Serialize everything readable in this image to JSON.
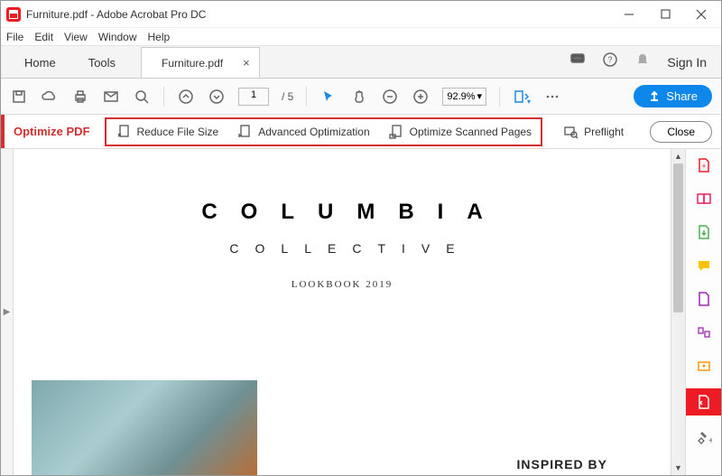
{
  "titlebar": {
    "title": "Furniture.pdf - Adobe Acrobat Pro DC"
  },
  "menubar": [
    "File",
    "Edit",
    "View",
    "Window",
    "Help"
  ],
  "tabs": {
    "home": "Home",
    "tools": "Tools",
    "doc": "Furniture.pdf",
    "signin": "Sign In"
  },
  "toolbar": {
    "page_current": "1",
    "page_total": "/ 5",
    "zoom": "92.9%",
    "share": "Share"
  },
  "optimize": {
    "label": "Optimize PDF",
    "reduce": "Reduce File Size",
    "advanced": "Advanced Optimization",
    "scanned": "Optimize Scanned Pages",
    "preflight": "Preflight",
    "close": "Close"
  },
  "document": {
    "title1": "COLUMBIA",
    "title2": "COLLECTIVE",
    "subtitle": "LOOKBOOK 2019",
    "inspired": "INSPIRED BY"
  }
}
